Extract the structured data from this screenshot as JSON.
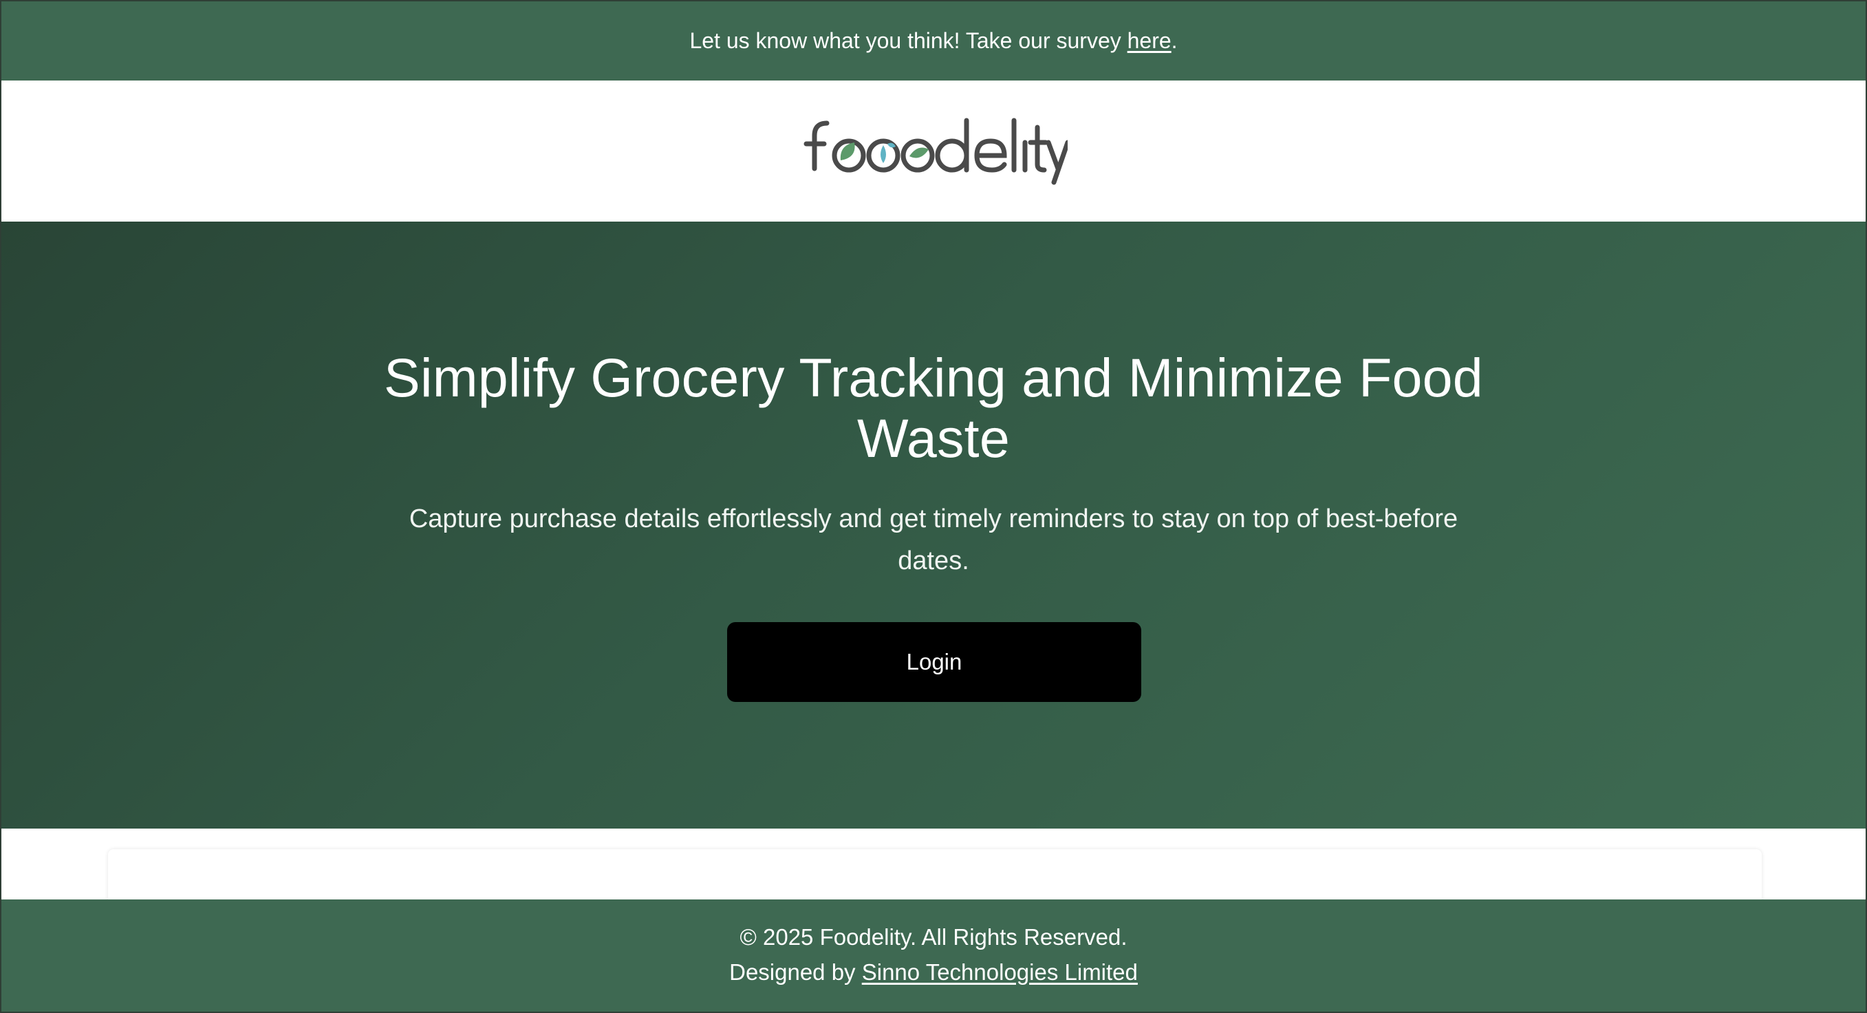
{
  "survey_banner": {
    "text": "Let us know what you think! Take our survey ",
    "link_label": "here",
    "suffix": "."
  },
  "header": {
    "logo_text": "foodelity",
    "logo_icon": "leaf-droplet-icon"
  },
  "hero": {
    "title": "Simplify Grocery Tracking and Minimize Food Waste",
    "subtitle": "Capture purchase details effortlessly and get timely reminders to stay on top of best-before dates.",
    "login_label": "Login"
  },
  "footer": {
    "copyright": "© 2025 Foodelity. All Rights Reserved.",
    "designed_by": "Designed by ",
    "designer_link": "Sinno Technologies Limited"
  },
  "colors": {
    "brand_green": "#3e6952",
    "hero_dark": "#294536",
    "button": "#000000",
    "logo_text": "#4a4a4a",
    "leaf_green": "#5c9a6a",
    "drop_teal": "#5fb3c4"
  }
}
